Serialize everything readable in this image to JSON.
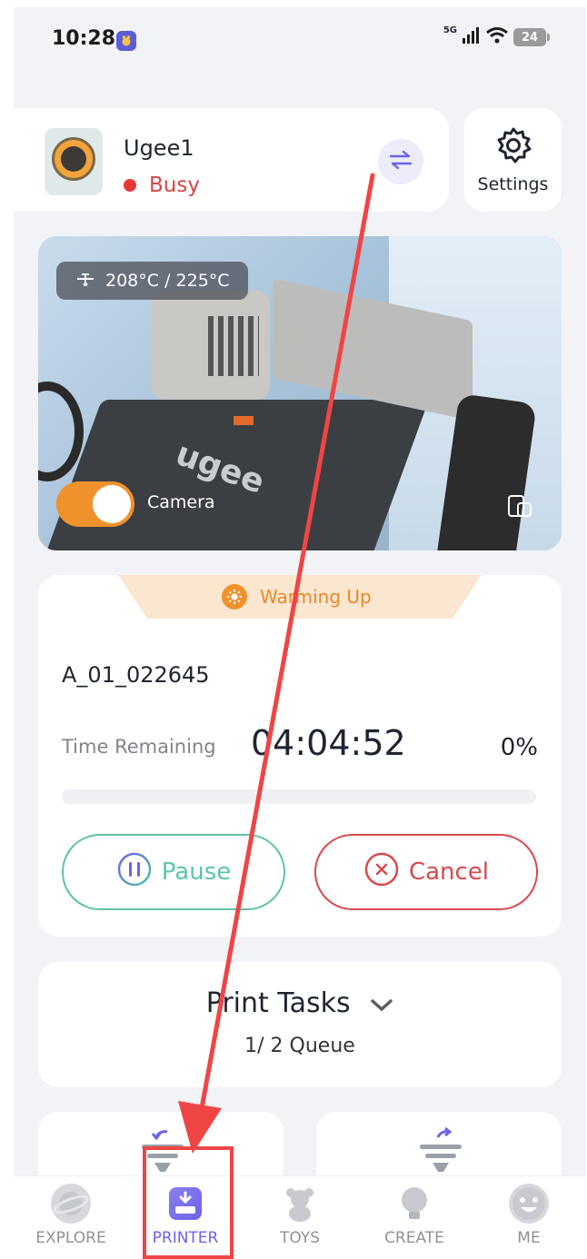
{
  "status_bar": {
    "time": "10:28",
    "network": "5G",
    "battery": "24"
  },
  "device": {
    "name": "Ugee1",
    "status": "Busy"
  },
  "settings": {
    "label": "Settings"
  },
  "camera": {
    "temperature": "208°C / 225°C",
    "label": "Camera",
    "enabled": true
  },
  "job": {
    "state": "Warming Up",
    "file_name": "A_01_022645",
    "time_label": "Time Remaining",
    "time_remaining": "04:04:52",
    "percent": "0%",
    "progress": 0,
    "pause_label": "Pause",
    "cancel_label": "Cancel"
  },
  "print_tasks": {
    "title": "Print Tasks",
    "queue": "1/ 2 Queue"
  },
  "nav": {
    "items": [
      {
        "label": "EXPLORE",
        "icon": "planet-icon"
      },
      {
        "label": "PRINTER",
        "icon": "printer-icon",
        "active": true
      },
      {
        "label": "TOYS",
        "icon": "teddy-bear-icon"
      },
      {
        "label": "CREATE",
        "icon": "lightbulb-icon"
      },
      {
        "label": "ME",
        "icon": "smiley-face-icon"
      }
    ]
  },
  "colors": {
    "accent": "#6e62e8",
    "busy": "#e53935",
    "warming": "#f0922b",
    "pause": "#5ec5a7",
    "cancel": "#d8494e",
    "annotation": "#f04545"
  }
}
